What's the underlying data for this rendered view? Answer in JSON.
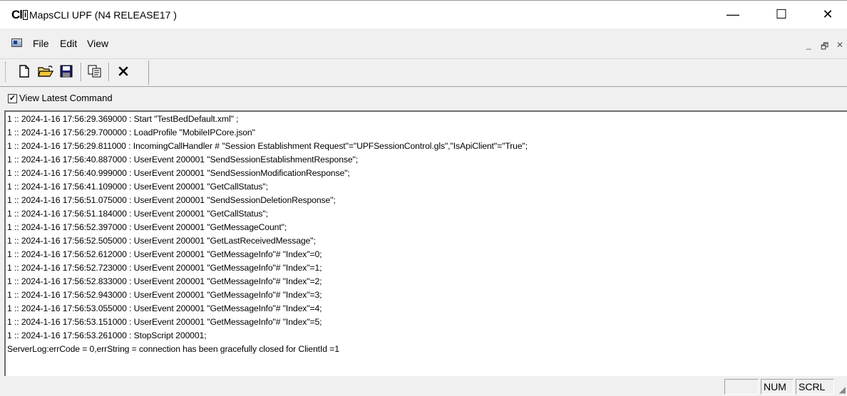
{
  "window": {
    "title": "MapsCLI UPF (N4 RELEASE17 )",
    "icon_text": "Cl",
    "icon_text_box": "i",
    "controls": {
      "minimize": "—",
      "maximize": "☐",
      "close": "✕"
    }
  },
  "menu": {
    "items": [
      "File",
      "Edit",
      "View"
    ],
    "mdi_controls": {
      "minimize": "_",
      "restore": "🗗",
      "close": "✕"
    }
  },
  "toolbar": {
    "icons": [
      "new-file-icon",
      "open-folder-icon",
      "save-disk-icon",
      "copy-icon",
      "delete-x-icon"
    ]
  },
  "options": {
    "view_latest_command": {
      "label": "View Latest Command",
      "checked": true
    }
  },
  "log": {
    "lines": [
      "1 :: 2024-1-16 17:56:29.369000 : Start \"TestBedDefault.xml\" ;",
      "1 :: 2024-1-16 17:56:29.700000 : LoadProfile \"MobileIPCore.json\"",
      "1 :: 2024-1-16 17:56:29.811000 : IncomingCallHandler # \"Session Establishment Request\"=\"UPFSessionControl.gls\",\"IsApiClient\"=\"True\";",
      "1 :: 2024-1-16 17:56:40.887000 : UserEvent 200001 \"SendSessionEstablishmentResponse\";",
      "1 :: 2024-1-16 17:56:40.999000 : UserEvent 200001 \"SendSessionModificationResponse\";",
      "1 :: 2024-1-16 17:56:41.109000 : UserEvent 200001 \"GetCallStatus\";",
      "1 :: 2024-1-16 17:56:51.075000 : UserEvent 200001 \"SendSessionDeletionResponse\";",
      "1 :: 2024-1-16 17:56:51.184000 : UserEvent 200001 \"GetCallStatus\";",
      "1 :: 2024-1-16 17:56:52.397000 : UserEvent 200001 \"GetMessageCount\";",
      "1 :: 2024-1-16 17:56:52.505000 : UserEvent 200001 \"GetLastReceivedMessage\";",
      "1 :: 2024-1-16 17:56:52.612000 : UserEvent 200001 \"GetMessageInfo\"# \"Index\"=0;",
      "1 :: 2024-1-16 17:56:52.723000 : UserEvent 200001 \"GetMessageInfo\"# \"Index\"=1;",
      "1 :: 2024-1-16 17:56:52.833000 : UserEvent 200001 \"GetMessageInfo\"# \"Index\"=2;",
      "1 :: 2024-1-16 17:56:52.943000 : UserEvent 200001 \"GetMessageInfo\"# \"Index\"=3;",
      "1 :: 2024-1-16 17:56:53.055000 : UserEvent 200001 \"GetMessageInfo\"# \"Index\"=4;",
      "1 :: 2024-1-16 17:56:53.151000 : UserEvent 200001 \"GetMessageInfo\"# \"Index\"=5;",
      "1 :: 2024-1-16 17:56:53.261000 : StopScript 200001;",
      "ServerLog:errCode = 0,errString = connection has been gracefully closed for ClientId =1"
    ]
  },
  "statusbar": {
    "cells": [
      "",
      "NUM",
      "SCRL"
    ]
  }
}
